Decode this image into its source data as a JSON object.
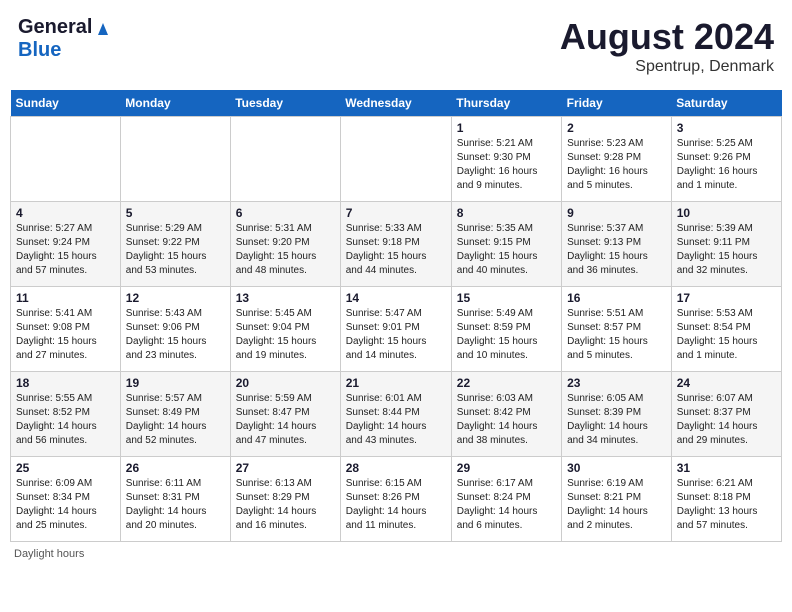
{
  "header": {
    "logo_general": "General",
    "logo_blue": "Blue",
    "month_year": "August 2024",
    "location": "Spentrup, Denmark"
  },
  "weekdays": [
    "Sunday",
    "Monday",
    "Tuesday",
    "Wednesday",
    "Thursday",
    "Friday",
    "Saturday"
  ],
  "footer": {
    "note": "Daylight hours"
  },
  "weeks": [
    [
      {
        "day": "",
        "info": ""
      },
      {
        "day": "",
        "info": ""
      },
      {
        "day": "",
        "info": ""
      },
      {
        "day": "",
        "info": ""
      },
      {
        "day": "1",
        "info": "Sunrise: 5:21 AM\nSunset: 9:30 PM\nDaylight: 16 hours\nand 9 minutes."
      },
      {
        "day": "2",
        "info": "Sunrise: 5:23 AM\nSunset: 9:28 PM\nDaylight: 16 hours\nand 5 minutes."
      },
      {
        "day": "3",
        "info": "Sunrise: 5:25 AM\nSunset: 9:26 PM\nDaylight: 16 hours\nand 1 minute."
      }
    ],
    [
      {
        "day": "4",
        "info": "Sunrise: 5:27 AM\nSunset: 9:24 PM\nDaylight: 15 hours\nand 57 minutes."
      },
      {
        "day": "5",
        "info": "Sunrise: 5:29 AM\nSunset: 9:22 PM\nDaylight: 15 hours\nand 53 minutes."
      },
      {
        "day": "6",
        "info": "Sunrise: 5:31 AM\nSunset: 9:20 PM\nDaylight: 15 hours\nand 48 minutes."
      },
      {
        "day": "7",
        "info": "Sunrise: 5:33 AM\nSunset: 9:18 PM\nDaylight: 15 hours\nand 44 minutes."
      },
      {
        "day": "8",
        "info": "Sunrise: 5:35 AM\nSunset: 9:15 PM\nDaylight: 15 hours\nand 40 minutes."
      },
      {
        "day": "9",
        "info": "Sunrise: 5:37 AM\nSunset: 9:13 PM\nDaylight: 15 hours\nand 36 minutes."
      },
      {
        "day": "10",
        "info": "Sunrise: 5:39 AM\nSunset: 9:11 PM\nDaylight: 15 hours\nand 32 minutes."
      }
    ],
    [
      {
        "day": "11",
        "info": "Sunrise: 5:41 AM\nSunset: 9:08 PM\nDaylight: 15 hours\nand 27 minutes."
      },
      {
        "day": "12",
        "info": "Sunrise: 5:43 AM\nSunset: 9:06 PM\nDaylight: 15 hours\nand 23 minutes."
      },
      {
        "day": "13",
        "info": "Sunrise: 5:45 AM\nSunset: 9:04 PM\nDaylight: 15 hours\nand 19 minutes."
      },
      {
        "day": "14",
        "info": "Sunrise: 5:47 AM\nSunset: 9:01 PM\nDaylight: 15 hours\nand 14 minutes."
      },
      {
        "day": "15",
        "info": "Sunrise: 5:49 AM\nSunset: 8:59 PM\nDaylight: 15 hours\nand 10 minutes."
      },
      {
        "day": "16",
        "info": "Sunrise: 5:51 AM\nSunset: 8:57 PM\nDaylight: 15 hours\nand 5 minutes."
      },
      {
        "day": "17",
        "info": "Sunrise: 5:53 AM\nSunset: 8:54 PM\nDaylight: 15 hours\nand 1 minute."
      }
    ],
    [
      {
        "day": "18",
        "info": "Sunrise: 5:55 AM\nSunset: 8:52 PM\nDaylight: 14 hours\nand 56 minutes."
      },
      {
        "day": "19",
        "info": "Sunrise: 5:57 AM\nSunset: 8:49 PM\nDaylight: 14 hours\nand 52 minutes."
      },
      {
        "day": "20",
        "info": "Sunrise: 5:59 AM\nSunset: 8:47 PM\nDaylight: 14 hours\nand 47 minutes."
      },
      {
        "day": "21",
        "info": "Sunrise: 6:01 AM\nSunset: 8:44 PM\nDaylight: 14 hours\nand 43 minutes."
      },
      {
        "day": "22",
        "info": "Sunrise: 6:03 AM\nSunset: 8:42 PM\nDaylight: 14 hours\nand 38 minutes."
      },
      {
        "day": "23",
        "info": "Sunrise: 6:05 AM\nSunset: 8:39 PM\nDaylight: 14 hours\nand 34 minutes."
      },
      {
        "day": "24",
        "info": "Sunrise: 6:07 AM\nSunset: 8:37 PM\nDaylight: 14 hours\nand 29 minutes."
      }
    ],
    [
      {
        "day": "25",
        "info": "Sunrise: 6:09 AM\nSunset: 8:34 PM\nDaylight: 14 hours\nand 25 minutes."
      },
      {
        "day": "26",
        "info": "Sunrise: 6:11 AM\nSunset: 8:31 PM\nDaylight: 14 hours\nand 20 minutes."
      },
      {
        "day": "27",
        "info": "Sunrise: 6:13 AM\nSunset: 8:29 PM\nDaylight: 14 hours\nand 16 minutes."
      },
      {
        "day": "28",
        "info": "Sunrise: 6:15 AM\nSunset: 8:26 PM\nDaylight: 14 hours\nand 11 minutes."
      },
      {
        "day": "29",
        "info": "Sunrise: 6:17 AM\nSunset: 8:24 PM\nDaylight: 14 hours\nand 6 minutes."
      },
      {
        "day": "30",
        "info": "Sunrise: 6:19 AM\nSunset: 8:21 PM\nDaylight: 14 hours\nand 2 minutes."
      },
      {
        "day": "31",
        "info": "Sunrise: 6:21 AM\nSunset: 8:18 PM\nDaylight: 13 hours\nand 57 minutes."
      }
    ]
  ]
}
